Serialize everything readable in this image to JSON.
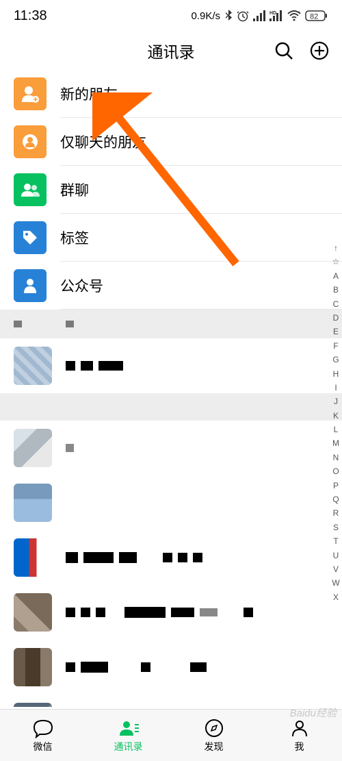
{
  "status": {
    "time": "11:38",
    "speed": "0.9K/s",
    "battery": "82"
  },
  "header": {
    "title": "通讯录"
  },
  "func_items": [
    {
      "label": "新的朋友",
      "color": "#fa9d3b",
      "icon": "person-add"
    },
    {
      "label": "仅聊天的朋友",
      "color": "#fa9d3b",
      "icon": "chat-person"
    },
    {
      "label": "群聊",
      "color": "#07c160",
      "icon": "group"
    },
    {
      "label": "标签",
      "color": "#2782d7",
      "icon": "tag"
    },
    {
      "label": "公众号",
      "color": "#2782d7",
      "icon": "official"
    }
  ],
  "index_letters": [
    "↑",
    "☆",
    "A",
    "B",
    "C",
    "D",
    "E",
    "F",
    "G",
    "H",
    "I",
    "J",
    "K",
    "L",
    "M",
    "N",
    "O",
    "P",
    "Q",
    "R",
    "S",
    "T",
    "U",
    "V",
    "W",
    "X"
  ],
  "nav": {
    "items": [
      {
        "label": "微信",
        "icon": "chat"
      },
      {
        "label": "通讯录",
        "icon": "contacts"
      },
      {
        "label": "发现",
        "icon": "discover"
      },
      {
        "label": "我",
        "icon": "me"
      }
    ],
    "active_index": 1
  },
  "watermark": "Baidu经验"
}
